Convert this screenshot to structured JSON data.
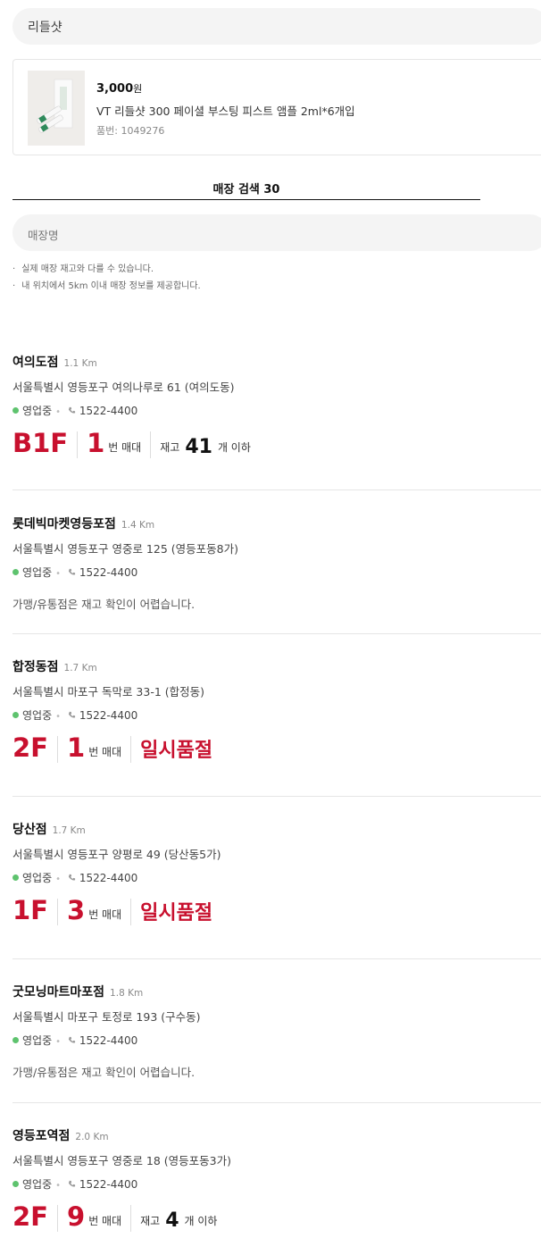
{
  "search": {
    "query": "리들샷",
    "store_placeholder": "매장명"
  },
  "product": {
    "price": "3,000",
    "currency": "원",
    "name": "VT 리들샷 300 페이셜 부스팅 피스트 앰플 2ml*6개입",
    "code": "품번: 1049276"
  },
  "tab": {
    "label": "매장 검색 30"
  },
  "notes": [
    "실제 매장 재고와 다를 수 있습니다.",
    "내 위치에서 5km 이내 매장 정보를 제공합니다."
  ],
  "labels": {
    "open": "영업중",
    "aisle_suffix": "번 매대",
    "stock_prefix": "재고",
    "stock_suffix": "개 이하",
    "soldout": "일시품절",
    "franchise": "가맹/유통점은 재고 확인이 어렵습니다."
  },
  "stores": [
    {
      "name": "여의도점",
      "distance": "1.1 Km",
      "address": "서울특별시 영등포구 여의나루로 61 (여의도동)",
      "phone": "1522-4400",
      "floor": "B1F",
      "aisle": "1",
      "stock": "41"
    },
    {
      "name": "롯데빅마켓영등포점",
      "distance": "1.4 Km",
      "address": "서울특별시 영등포구 영중로 125 (영등포동8가)",
      "phone": "1522-4400"
    },
    {
      "name": "합정동점",
      "distance": "1.7 Km",
      "address": "서울특별시 마포구 독막로 33-1 (합정동)",
      "phone": "1522-4400",
      "floor": "2F",
      "aisle": "1"
    },
    {
      "name": "당산점",
      "distance": "1.7 Km",
      "address": "서울특별시 영등포구 양평로 49 (당산동5가)",
      "phone": "1522-4400",
      "floor": "1F",
      "aisle": "3"
    },
    {
      "name": "굿모닝마트마포점",
      "distance": "1.8 Km",
      "address": "서울특별시 마포구 토정로 193 (구수동)",
      "phone": "1522-4400"
    },
    {
      "name": "영등포역점",
      "distance": "2.0 Km",
      "address": "서울특별시 영등포구 영중로 18 (영등포동3가)",
      "phone": "1522-4400",
      "floor": "2F",
      "aisle": "9",
      "stock": "4"
    }
  ],
  "colors": {
    "accent": "#c8102e",
    "open": "#5ec36e"
  }
}
